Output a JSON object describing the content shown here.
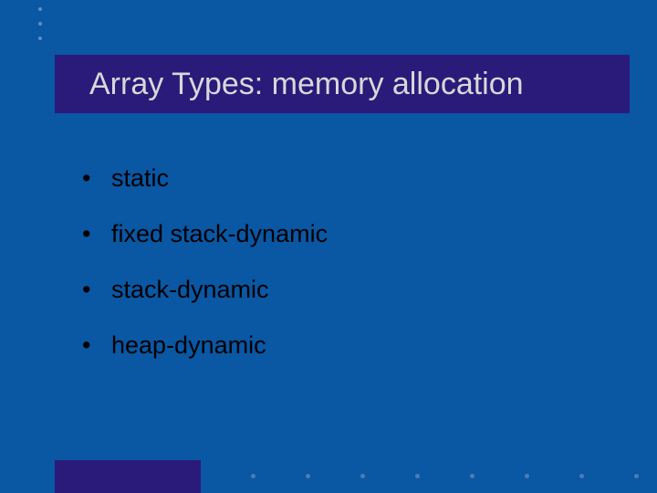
{
  "title": "Array Types: memory allocation",
  "bullets": [
    "static",
    "fixed stack-dynamic",
    "stack-dynamic",
    "heap-dynamic"
  ]
}
